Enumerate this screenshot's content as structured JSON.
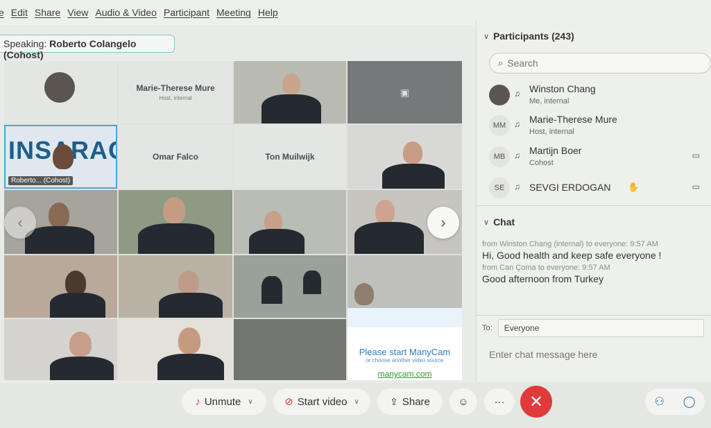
{
  "menu": {
    "items": [
      "e",
      "Edit",
      "Share",
      "View",
      "Audio & Video",
      "Participant",
      "Meeting",
      "Help"
    ]
  },
  "speaking": {
    "prefix": "Speaking: ",
    "name": "Roberto Colangelo (Cohost)"
  },
  "grid": {
    "tiles": {
      "marie_name": "Marie-Therese Mure",
      "marie_role": "Host, internal",
      "omar_name": "Omar Falco",
      "ton_name": "Ton Muilwijk",
      "speaker_label": "Roberto... (Cohost)",
      "insarag_text": "INSARAG"
    },
    "manycam": {
      "title": "Please start ManyCam",
      "subtitle": "or choose another video source",
      "link": "manycam.com"
    }
  },
  "participants": {
    "header": "Participants (243)",
    "search_placeholder": "Search",
    "list": [
      {
        "name": "Winston Chang",
        "role": "Me, internal",
        "initials": ""
      },
      {
        "name": "Marie-Therese Mure",
        "role": "Host, internal",
        "initials": "MM"
      },
      {
        "name": "Martijn Boer",
        "role": "Cohost",
        "initials": "MB"
      },
      {
        "name": "SEVGI ERDOGAN",
        "role": "",
        "initials": "SE"
      }
    ]
  },
  "chat": {
    "header": "Chat",
    "messages": [
      {
        "meta": "from Winston Chang (internal) to everyone:   9:57 AM",
        "text": "Hi, Good health and keep safe everyone !"
      },
      {
        "meta": "from Can Çoma to everyone:   9:57 AM",
        "text": "Good afternoon from Turkey"
      }
    ],
    "to_label": "To:",
    "to_value": "Everyone",
    "input_placeholder": "Enter chat message here"
  },
  "toolbar": {
    "unmute": "Unmute",
    "start_video": "Start video",
    "share": "Share"
  },
  "colors": {
    "end_button": "#e03a3a",
    "accent_blue": "#2b6fa8",
    "speaker_border": "#49a6d8"
  }
}
